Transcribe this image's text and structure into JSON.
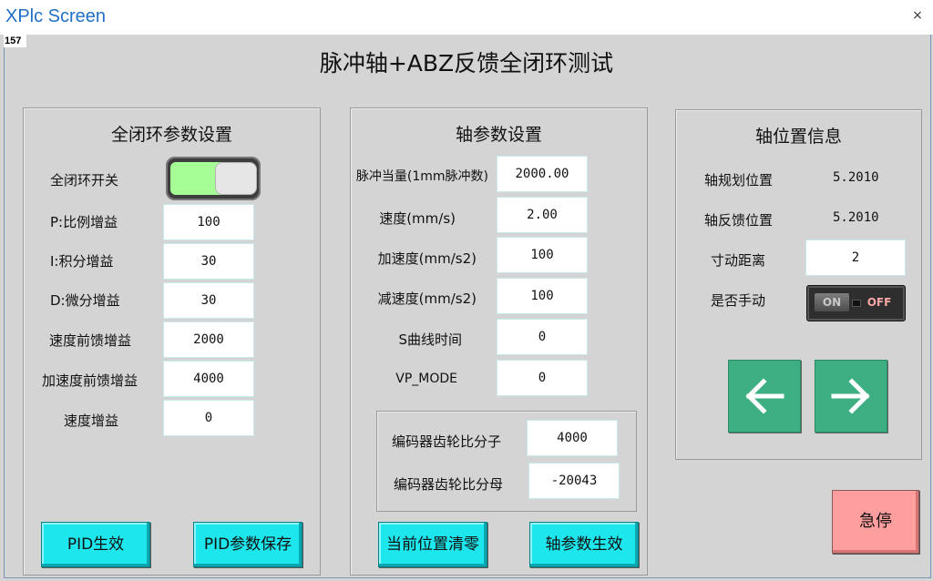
{
  "window": {
    "title": "XPlc Screen",
    "close_glyph": "×",
    "frame_counter": "157"
  },
  "page_title": "脉冲轴+ABZ反馈全闭环测试",
  "closed_loop_panel": {
    "title": "全闭环参数设置",
    "switch_label": "全闭环开关",
    "switch_state": "on",
    "rows": [
      {
        "label": "P:比例增益",
        "value": "100"
      },
      {
        "label": "I:积分增益",
        "value": "30"
      },
      {
        "label": "D:微分增益",
        "value": "30"
      },
      {
        "label": "速度前馈增益",
        "value": "2000"
      },
      {
        "label": "加速度前馈增益",
        "value": "4000"
      },
      {
        "label": "速度增益",
        "value": "0"
      }
    ],
    "pid_apply_label": "PID生效",
    "pid_save_label": "PID参数保存"
  },
  "axis_panel": {
    "title": "轴参数设置",
    "rows": [
      {
        "label": "脉冲当量(1mm脉冲数)",
        "value": "2000.00"
      },
      {
        "label": "速度(mm/s)",
        "value": "2.00"
      },
      {
        "label": "加速度(mm/s2)",
        "value": "100"
      },
      {
        "label": "减速度(mm/s2)",
        "value": "100"
      },
      {
        "label": "S曲线时间",
        "value": "0"
      },
      {
        "label": "VP_MODE",
        "value": "0"
      }
    ],
    "encoder": {
      "numerator_label": "编码器齿轮比分子",
      "numerator_value": "4000",
      "denominator_label": "编码器齿轮比分母",
      "denominator_value": "-20043"
    },
    "clear_pos_label": "当前位置清零",
    "apply_label": "轴参数生效"
  },
  "position_panel": {
    "title": "轴位置信息",
    "planned_label": "轴规划位置",
    "planned_value": "5.2010",
    "feedback_label": "轴反馈位置",
    "feedback_value": "5.2010",
    "jog_label": "寸动距离",
    "jog_value": "2",
    "manual_label": "是否手动",
    "manual_on": "ON",
    "manual_off": "OFF",
    "manual_state": "off"
  },
  "estop_label": "急停",
  "colors": {
    "accent_cyan": "#1de6ec",
    "arrow_green": "#3eaf82",
    "estop_red": "#ff9e9e",
    "switch_on": "#a6ff96"
  },
  "icons": {
    "left": "arrow-left-icon",
    "right": "arrow-right-icon"
  }
}
